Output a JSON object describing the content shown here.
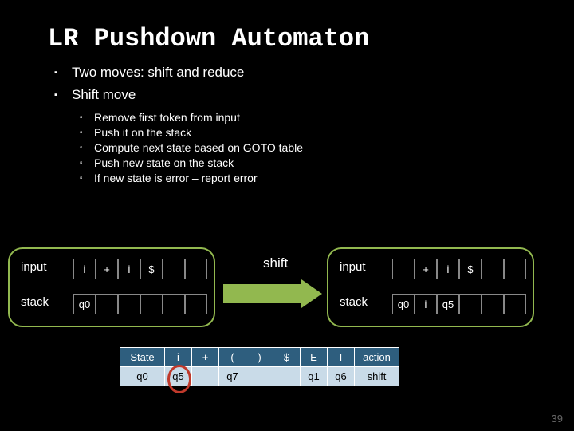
{
  "title": "LR Pushdown Automaton",
  "bullets_l1": [
    "Two moves: shift and reduce",
    "Shift move"
  ],
  "bullets_l2": [
    "Remove first token from input",
    "Push it on the stack",
    "Compute next state based on GOTO table",
    "Push new state on the stack",
    "If new state is error – report error"
  ],
  "left": {
    "input_label": "input",
    "stack_label": "stack",
    "input_cells": [
      "i",
      "+",
      "i",
      "$"
    ],
    "stack_cells": [
      "q0"
    ]
  },
  "shift_label": "shift",
  "right": {
    "input_label": "input",
    "stack_label": "stack",
    "input_cells": [
      "+",
      "i",
      "$"
    ],
    "stack_cells": [
      "q0",
      "i",
      "q5"
    ]
  },
  "table": {
    "headers": [
      "State",
      "i",
      "+",
      "(",
      ")",
      "$",
      "E",
      "T",
      "action"
    ],
    "row": [
      "q0",
      "q5",
      "",
      "q7",
      "",
      "",
      "q1",
      "q6",
      "shift"
    ]
  },
  "page_number": "39",
  "chart_data": {
    "type": "table",
    "description": "Parsing action/goto table row for state q0",
    "columns": [
      "State",
      "i",
      "+",
      "(",
      ")",
      "$",
      "E",
      "T",
      "action"
    ],
    "rows": [
      {
        "State": "q0",
        "i": "q5",
        "+": "",
        "(": "q7",
        ")": "",
        "$": "",
        "E": "q1",
        "T": "q6",
        "action": "shift"
      }
    ],
    "highlighted_cell": {
      "row": 0,
      "column": "i",
      "value": "q5"
    }
  }
}
